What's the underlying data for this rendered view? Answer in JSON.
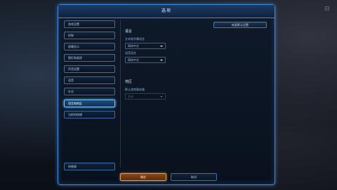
{
  "dialog": {
    "title": "选项"
  },
  "sidebar": {
    "items": [
      {
        "label": "游戏设置"
      },
      {
        "label": "控制"
      },
      {
        "label": "屏幕显示"
      },
      {
        "label": "图形和画质"
      },
      {
        "label": "声音设置"
      },
      {
        "label": "语音"
      },
      {
        "label": "社交"
      },
      {
        "label": "语言和地区"
      },
      {
        "label": "当前的按键"
      }
    ],
    "bottom_item": {
      "label": "快捷键"
    }
  },
  "content": {
    "top_button": "恢复默认设置",
    "language_section": {
      "heading": "语言",
      "text_label": "文本和字幕语言",
      "text_value": "简体中文",
      "voice_label": "语音语言",
      "voice_value": "简体中文"
    },
    "region_section": {
      "heading": "地区",
      "region_label": "默认游戏服务器",
      "region_value": "亚洲"
    }
  },
  "footer": {
    "ok_label": "确定",
    "cancel_label": "取消"
  }
}
